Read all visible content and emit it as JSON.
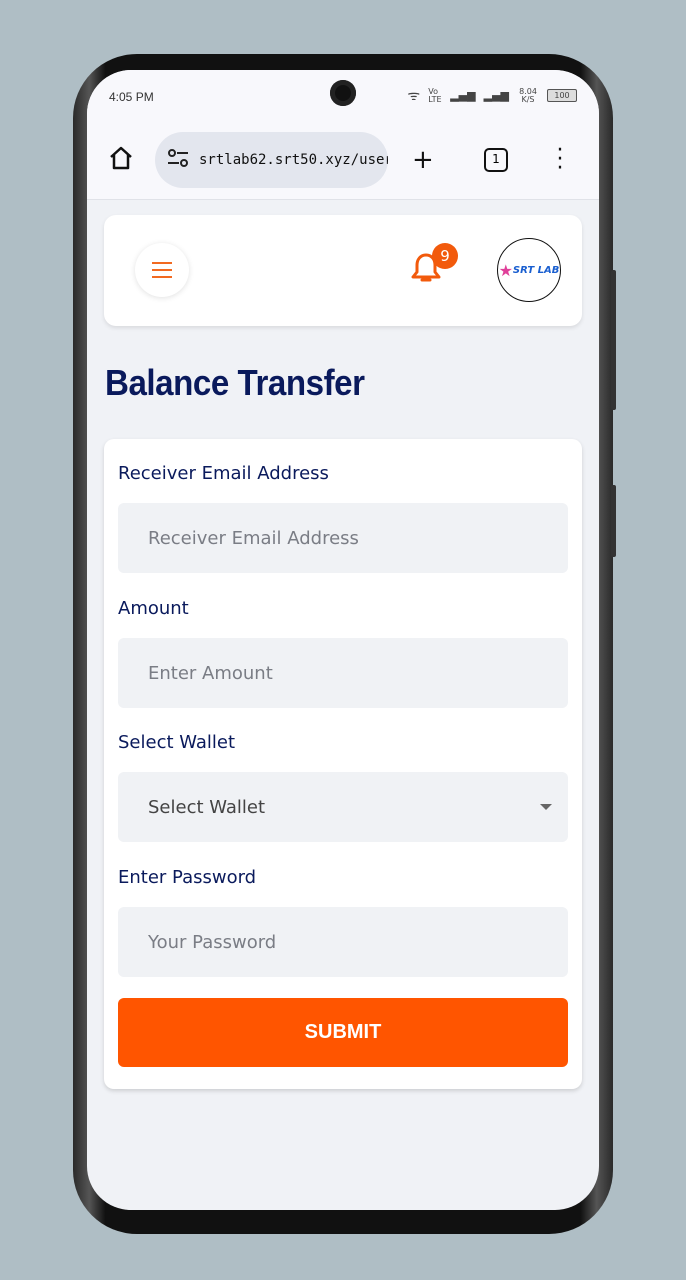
{
  "status": {
    "time": "4:05 PM",
    "network": "Vo LTE",
    "speed": "8.04 K/S",
    "battery": "100"
  },
  "browser": {
    "url": "srtlab62.srt50.xyz/user/r",
    "tab_count": "1"
  },
  "header": {
    "notification_count": "9",
    "logo_text": "SRT LAB"
  },
  "page": {
    "title": "Balance Transfer"
  },
  "form": {
    "email_label": "Receiver Email Address",
    "email_placeholder": "Receiver Email Address",
    "amount_label": "Amount",
    "amount_placeholder": "Enter Amount",
    "wallet_label": "Select Wallet",
    "wallet_value": "Select Wallet",
    "password_label": "Enter Password",
    "password_placeholder": "Your Password",
    "submit_label": "SUBMIT"
  },
  "colors": {
    "accent": "#ff5500",
    "title": "#0a1a5c"
  }
}
